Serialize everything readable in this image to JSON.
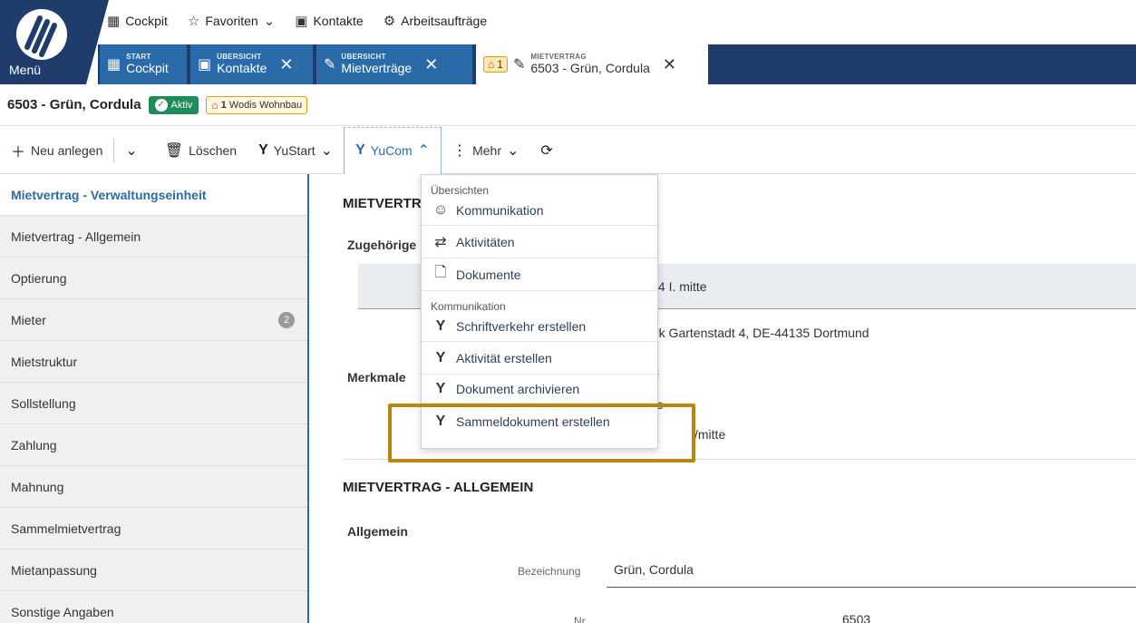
{
  "header": {
    "menu_label": "Menü",
    "topnav": [
      {
        "label": "Cockpit",
        "icon": "cockpit-icon"
      },
      {
        "label": "Favoriten",
        "icon": "star-icon"
      },
      {
        "label": "Kontakte",
        "icon": "contacts-icon"
      },
      {
        "label": "Arbeitsaufträge",
        "icon": "tasks-icon"
      }
    ]
  },
  "tabs": [
    {
      "small": "START",
      "label": "Cockpit",
      "closable": false
    },
    {
      "small": "ÜBERSICHT",
      "label": "Kontakte",
      "closable": true
    },
    {
      "small": "ÜBERSICHT",
      "label": "Mietverträge",
      "closable": true
    },
    {
      "small": "MIETVERTRAG",
      "label": "6503 - Grün, Cordula",
      "badge": "1",
      "closable": true,
      "active": true
    }
  ],
  "record": {
    "title": "6503 - Grün, Cordula",
    "status": "Aktiv",
    "wohnbau_count": "1",
    "wohnbau_label": "Wodis Wohnbau"
  },
  "toolbar": {
    "new": "Neu anlegen",
    "delete": "Löschen",
    "yustart": "YuStart",
    "yucom": "YuCom",
    "more": "Mehr"
  },
  "sidebar": [
    {
      "label": "Mietvertrag - Verwaltungseinheit",
      "active": true
    },
    {
      "label": "Mietvertrag - Allgemein"
    },
    {
      "label": "Optierung"
    },
    {
      "label": "Mieter",
      "count": "2"
    },
    {
      "label": "Mietstruktur"
    },
    {
      "label": "Sollstellung"
    },
    {
      "label": "Zahlung"
    },
    {
      "label": "Mahnung"
    },
    {
      "label": "Sammelmietvertrag"
    },
    {
      "label": "Mietanpassung"
    },
    {
      "label": "Sonstige Angaben"
    }
  ],
  "main": {
    "section1_title": "MIETVERTR",
    "zugehoerige": "Zugehörige",
    "row1_text": "/4 I. mitte",
    "address_text": "rk Gartenstadt 4, DE-44135 Dortmund",
    "merkmale": "Merkmale",
    "merkmale_val": "l",
    "merkmale_val2": "e",
    "mitte_text": "/mitte",
    "section2_title": "MIETVERTRAG - ALLGEMEIN",
    "allgemein": "Allgemein",
    "bezeichnung_label": "Bezeichnung",
    "bezeichnung_value": "Grün, Cordula",
    "nr_label": "Nr.",
    "nr_value": "6503"
  },
  "dropdown": {
    "group1": "Übersichten",
    "items1": [
      {
        "label": "Kommunikation",
        "icon": "chat-icon"
      },
      {
        "label": "Aktivitäten",
        "icon": "activity-icon"
      },
      {
        "label": "Dokumente",
        "icon": "document-icon"
      }
    ],
    "group2": "Kommunikation",
    "items2": [
      {
        "label": "Schriftverkehr erstellen",
        "icon": "yucom-icon"
      },
      {
        "label": "Aktivität erstellen",
        "icon": "yucom-icon"
      },
      {
        "label": "Dokument archivieren",
        "icon": "yucom-icon"
      },
      {
        "label": "Sammeldokument erstellen",
        "icon": "yucom-icon"
      }
    ]
  },
  "colors": {
    "brand_dark": "#1f3c6b",
    "brand_tab": "#2a6aa8",
    "active_green": "#1f8a5a",
    "highlight_frame": "#b8860b"
  }
}
